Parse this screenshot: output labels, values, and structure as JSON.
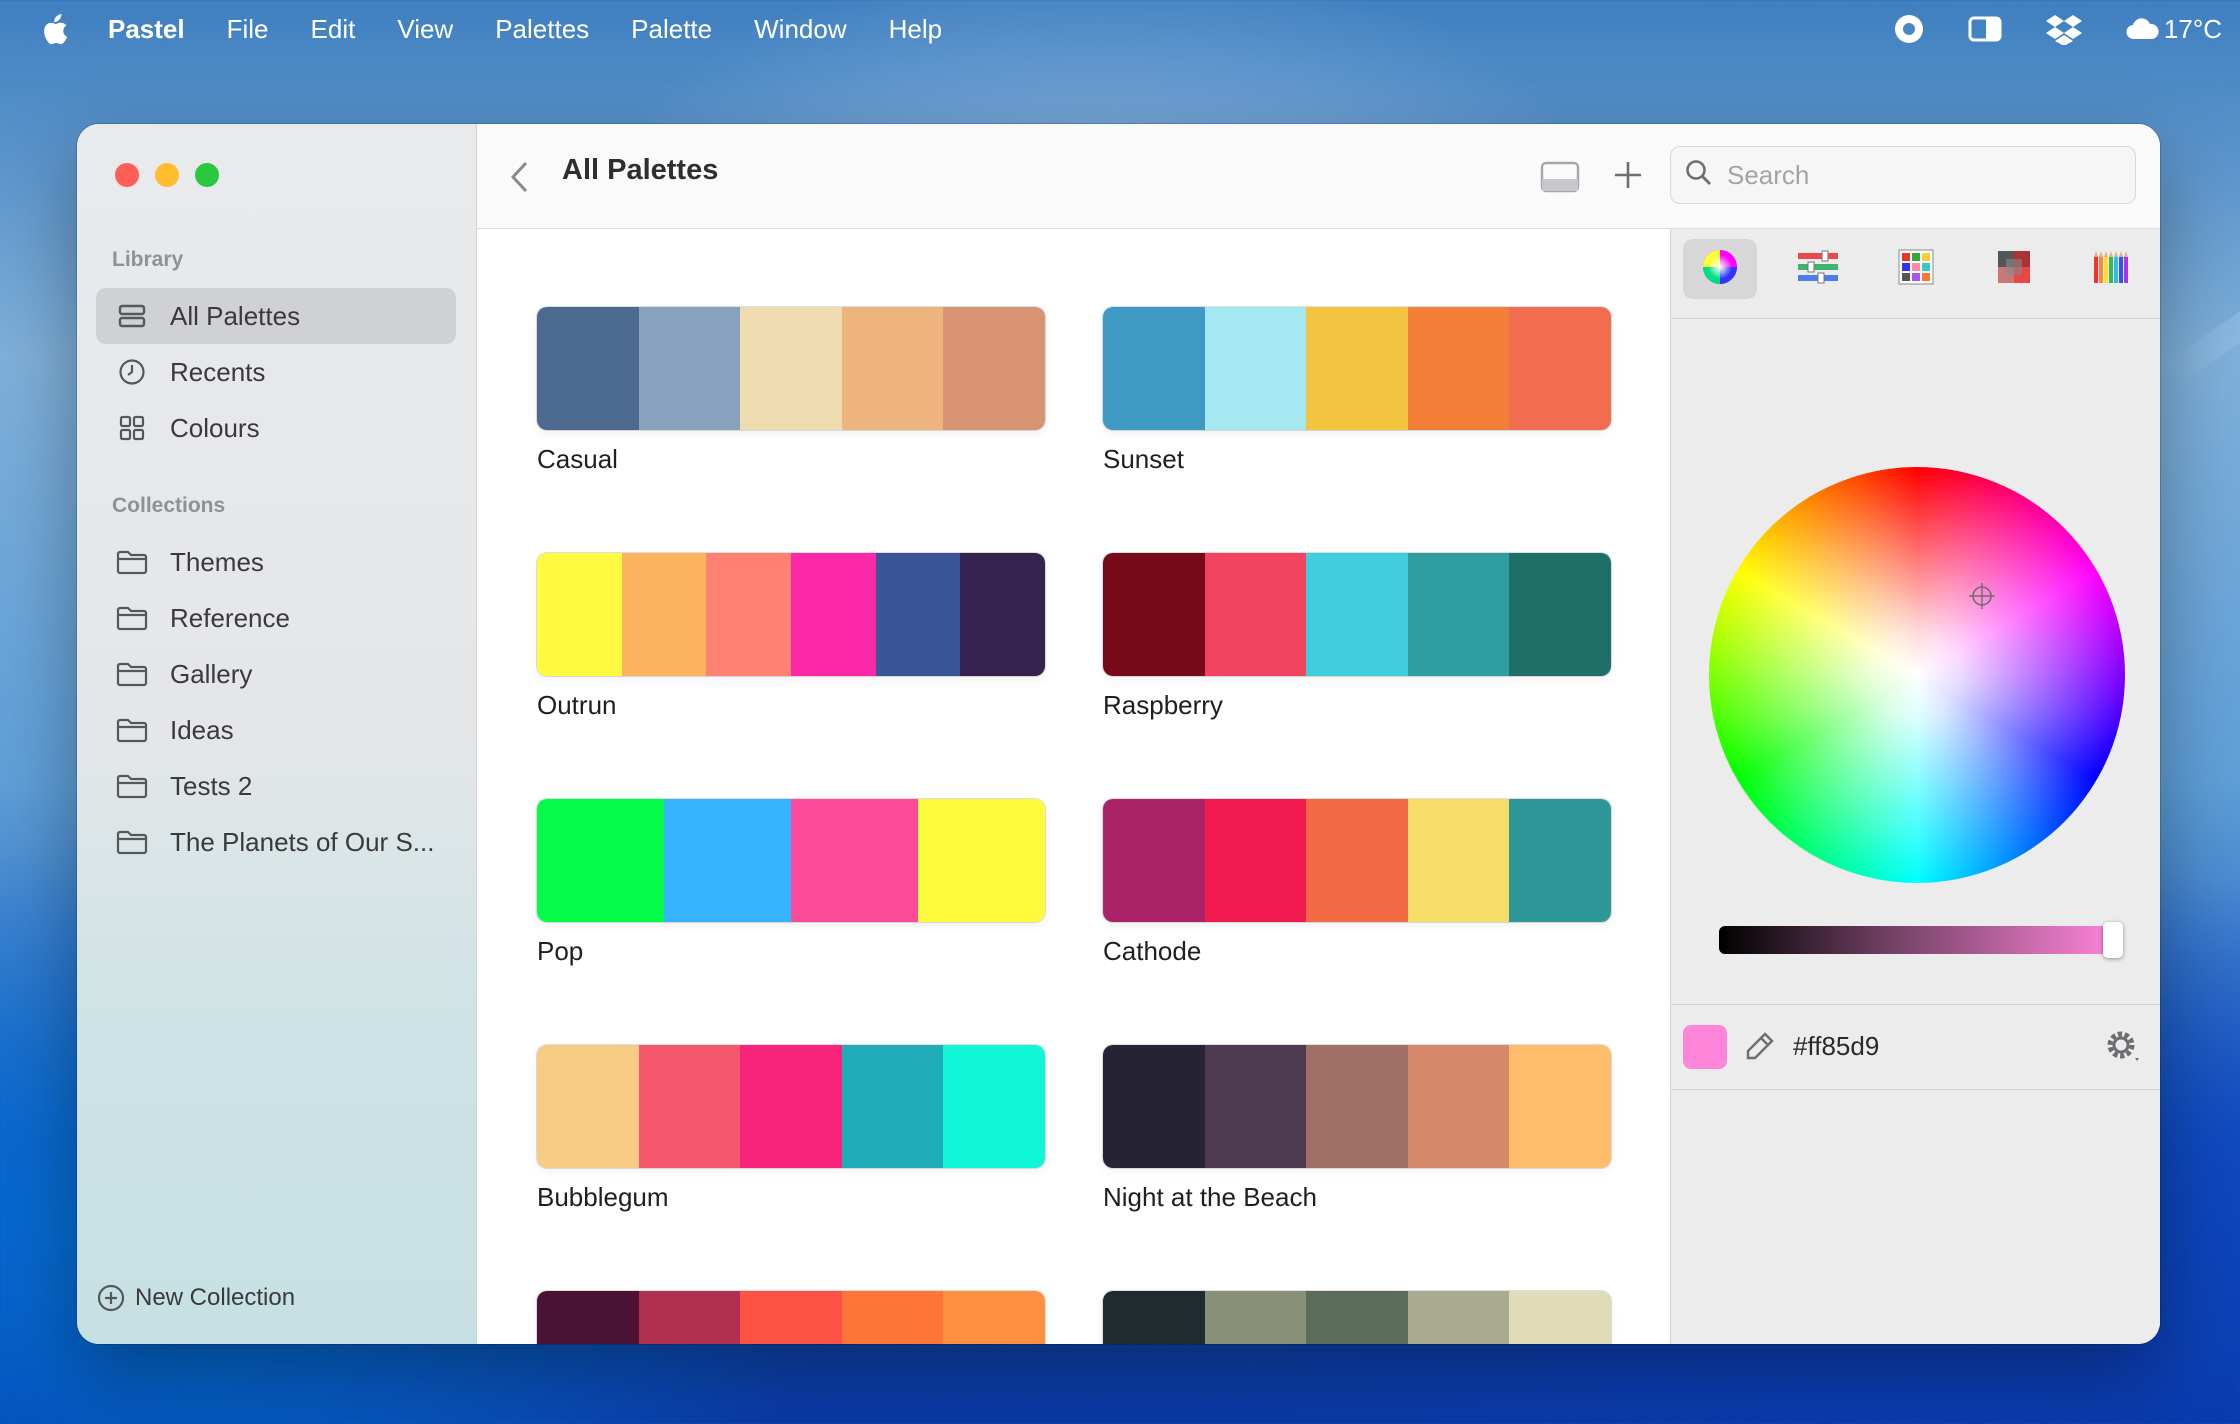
{
  "menubar": {
    "app_name": "Pastel",
    "menus": [
      "File",
      "Edit",
      "View",
      "Palettes",
      "Palette",
      "Window",
      "Help"
    ],
    "weather": "17°C"
  },
  "sidebar": {
    "library_heading": "Library",
    "library_items": [
      {
        "label": "All Palettes",
        "icon": "list-icon",
        "selected": true
      },
      {
        "label": "Recents",
        "icon": "clock-icon"
      },
      {
        "label": "Colours",
        "icon": "grid-icon"
      }
    ],
    "collections_heading": "Collections",
    "collections": [
      "Themes",
      "Reference",
      "Gallery",
      "Ideas",
      "Tests 2",
      "The Planets of Our S..."
    ],
    "new_collection_label": "New Collection"
  },
  "toolbar": {
    "title": "All Palettes",
    "search_placeholder": "Search"
  },
  "palettes": [
    {
      "name": "Casual",
      "colors": [
        "#4c6a90",
        "#88a2bd",
        "#eedbb0",
        "#eeb47e",
        "#d99474"
      ]
    },
    {
      "name": "Sunset",
      "colors": [
        "#3e9ac2",
        "#a6e8f2",
        "#f2c440",
        "#f27e37",
        "#f26c4f"
      ]
    },
    {
      "name": "Outrun",
      "colors": [
        "#fefa3f",
        "#fbb35f",
        "#fe8172",
        "#fb29a8",
        "#3a5596",
        "#35224d"
      ]
    },
    {
      "name": "Raspberry",
      "colors": [
        "#770a18",
        "#f24461",
        "#3fccdc",
        "#2e9fa1",
        "#1e6f68"
      ]
    },
    {
      "name": "Pop",
      "colors": [
        "#05fb4a",
        "#35b4fd",
        "#fd4b9b",
        "#fdfb3b"
      ]
    },
    {
      "name": "Cathode",
      "colors": [
        "#a92167",
        "#f21b50",
        "#f26a44",
        "#f6dc68",
        "#2e9898"
      ]
    },
    {
      "name": "Bubblegum",
      "colors": [
        "#f7cb81",
        "#f4576d",
        "#f72279",
        "#1fadb9",
        "#10f7d7"
      ]
    },
    {
      "name": "Night at the Beach",
      "colors": [
        "#252334",
        "#4d3a51",
        "#a06f66",
        "#d8886a",
        "#ffbc6a"
      ]
    },
    {
      "name": "",
      "colors": [
        "#4a1335",
        "#b03052",
        "#fe5247",
        "#fe7537",
        "#fe9042"
      ]
    },
    {
      "name": "",
      "colors": [
        "#202b2f",
        "#889077",
        "#5a6d5c",
        "#a8ab8f",
        "#e0dcb9"
      ]
    }
  ],
  "inspector": {
    "current_color": "#ff85d9",
    "hex_label": "#ff85d9",
    "active_tab": "color-wheel"
  }
}
